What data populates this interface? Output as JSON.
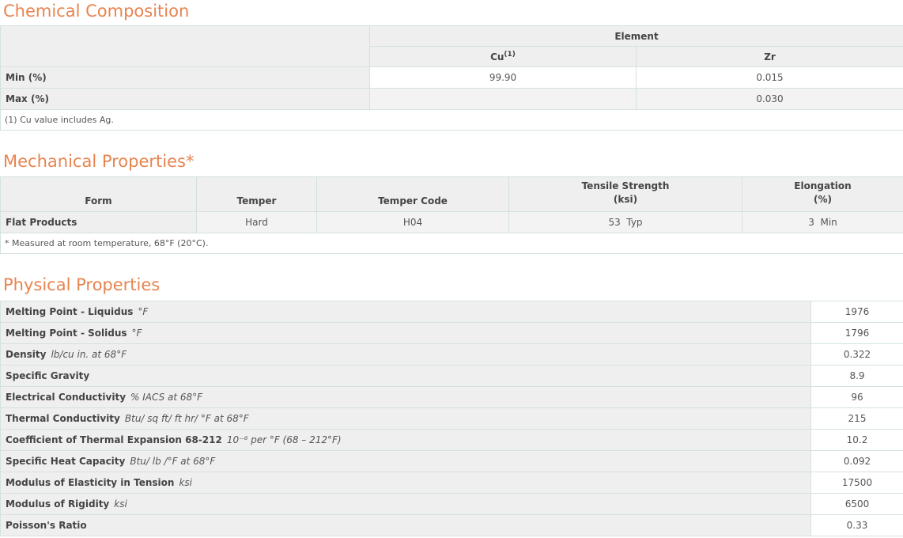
{
  "chemical": {
    "title": "Chemical Composition",
    "element_header": "Element",
    "columns": [
      {
        "symbol": "Cu",
        "sup": "(1)"
      },
      {
        "symbol": "Zr",
        "sup": ""
      }
    ],
    "rows": [
      {
        "label": "Min (%)",
        "values": [
          "99.90",
          "0.015"
        ]
      },
      {
        "label": "Max (%)",
        "values": [
          "",
          "0.030"
        ]
      }
    ],
    "note": "(1) Cu value includes Ag."
  },
  "mechanical": {
    "title": "Mechanical Properties*",
    "headers": {
      "form": "Form",
      "temper": "Temper",
      "temper_code": "Temper Code",
      "tensile_line1": "Tensile Strength",
      "tensile_line2": "(ksi)",
      "elongation_line1": "Elongation",
      "elongation_line2": "(%)"
    },
    "row": {
      "form": "Flat Products",
      "temper": "Hard",
      "temper_code": "H04",
      "tensile": "53  Typ",
      "elongation": "3  Min"
    },
    "note": "* Measured at room temperature, 68°F (20°C)."
  },
  "physical": {
    "title": "Physical Properties",
    "rows": [
      {
        "label": "Melting Point - Liquidus",
        "unit": "°F",
        "value": "1976"
      },
      {
        "label": "Melting Point - Solidus",
        "unit": "°F",
        "value": "1796"
      },
      {
        "label": "Density",
        "unit": "lb/cu in. at 68°F",
        "value": "0.322"
      },
      {
        "label": "Specific Gravity",
        "unit": "",
        "value": "8.9"
      },
      {
        "label": "Electrical Conductivity",
        "unit": "% IACS at 68°F",
        "value": "96"
      },
      {
        "label": "Thermal Conductivity",
        "unit": "Btu/ sq ft/ ft hr/ °F at 68°F",
        "value": "215"
      },
      {
        "label": "Coefficient of Thermal Expansion 68-212",
        "unit": "10⁻⁶ per °F (68 – 212°F)",
        "value": "10.2"
      },
      {
        "label": "Specific Heat Capacity",
        "unit": "Btu/ lb /°F at 68°F",
        "value": "0.092"
      },
      {
        "label": "Modulus of Elasticity in Tension",
        "unit": "ksi",
        "value": "17500"
      },
      {
        "label": "Modulus of Rigidity",
        "unit": "ksi",
        "value": "6500"
      },
      {
        "label": "Poisson's Ratio",
        "unit": "",
        "value": "0.33"
      }
    ]
  },
  "colors": {
    "accent": "#e8844f",
    "header_bg": "#efefef",
    "border": "#d4e2df"
  }
}
